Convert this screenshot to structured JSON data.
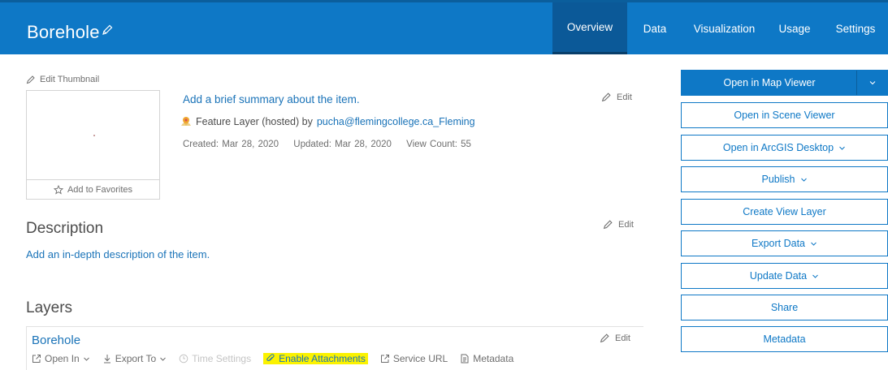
{
  "header": {
    "title": "Borehole",
    "tabs": [
      {
        "label": "Overview",
        "active": true
      },
      {
        "label": "Data"
      },
      {
        "label": "Visualization"
      },
      {
        "label": "Usage"
      },
      {
        "label": "Settings"
      }
    ]
  },
  "thumbnail": {
    "edit_label": "Edit Thumbnail",
    "favorites_label": "Add to Favorites"
  },
  "item": {
    "summary_placeholder": "Add a brief summary about the item.",
    "type_prefix": "Feature Layer (hosted) by",
    "owner": "pucha@flemingcollege.ca_Fleming",
    "created": "Created: Mar 28, 2020",
    "updated": "Updated: Mar 28, 2020",
    "view_count": "View Count: 55",
    "edit_label": "Edit"
  },
  "description": {
    "title": "Description",
    "placeholder": "Add an in-depth description of the item.",
    "edit_label": "Edit"
  },
  "layers": {
    "title": "Layers",
    "items": [
      {
        "name": "Borehole",
        "edit_label": "Edit",
        "actions": {
          "open_in": "Open In",
          "export_to": "Export To",
          "time_settings": "Time Settings",
          "enable_attachments": "Enable Attachments",
          "service_url": "Service URL",
          "metadata": "Metadata"
        }
      }
    ]
  },
  "actions": {
    "open_map_viewer": "Open in Map Viewer",
    "open_scene_viewer": "Open in Scene Viewer",
    "open_arcgis_desktop": "Open in ArcGIS Desktop",
    "publish": "Publish",
    "create_view_layer": "Create View Layer",
    "export_data": "Export Data",
    "update_data": "Update Data",
    "share": "Share",
    "metadata": "Metadata"
  },
  "colors": {
    "brand": "#0e78c6",
    "link": "#1a73b8",
    "highlight": "#fbf200"
  }
}
